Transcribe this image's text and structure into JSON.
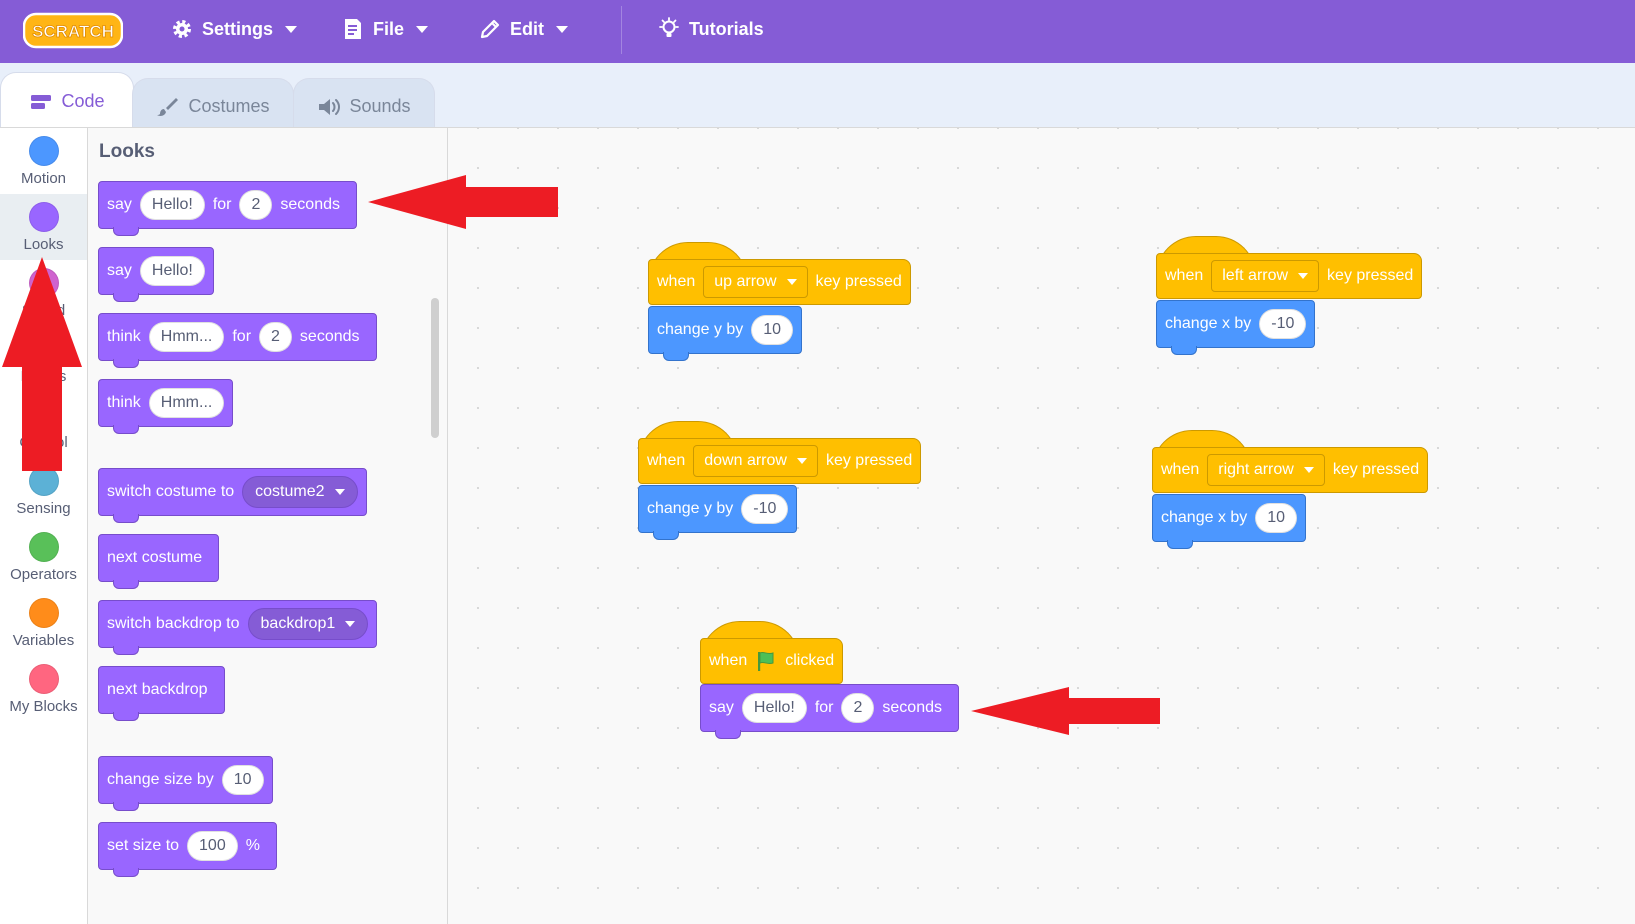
{
  "menu": {
    "logo_text": "SCRATCH",
    "settings": "Settings",
    "file": "File",
    "edit": "Edit",
    "tutorials": "Tutorials"
  },
  "tabs": [
    {
      "label": "Code",
      "icon": "code-icon",
      "active": true
    },
    {
      "label": "Costumes",
      "icon": "brush-icon",
      "active": false
    },
    {
      "label": "Sounds",
      "icon": "speaker-icon",
      "active": false
    }
  ],
  "categories": [
    {
      "label": "Motion",
      "color": "#4c97ff"
    },
    {
      "label": "Looks",
      "color": "#9966ff",
      "selected": true
    },
    {
      "label": "Sound",
      "color": "#cf63cf"
    },
    {
      "label": "Events",
      "color": "#ffbf00"
    },
    {
      "label": "Control",
      "color": "#ffab19"
    },
    {
      "label": "Sensing",
      "color": "#5cb1d6"
    },
    {
      "label": "Operators",
      "color": "#59c059"
    },
    {
      "label": "Variables",
      "color": "#ff8c1a"
    },
    {
      "label": "My Blocks",
      "color": "#ff6680"
    }
  ],
  "palette": {
    "title": "Looks",
    "say_for": {
      "say": "say",
      "msg": "Hello!",
      "for": "for",
      "secs": "2",
      "seconds": "seconds"
    },
    "say": {
      "say": "say",
      "msg": "Hello!"
    },
    "think_for": {
      "think": "think",
      "msg": "Hmm...",
      "for": "for",
      "secs": "2",
      "seconds": "seconds"
    },
    "think": {
      "think": "think",
      "msg": "Hmm..."
    },
    "switch_costume": {
      "label": "switch costume to",
      "value": "costume2"
    },
    "next_costume": "next costume",
    "switch_backdrop": {
      "label": "switch backdrop to",
      "value": "backdrop1"
    },
    "next_backdrop": "next backdrop",
    "change_size": {
      "label": "change size by",
      "value": "10"
    },
    "set_size": {
      "label": "set size to",
      "value": "100",
      "unit": "%"
    }
  },
  "workspace": {
    "up": {
      "when": "when",
      "key": "up arrow",
      "pressed": "key pressed",
      "action": "change y by",
      "value": "10"
    },
    "left": {
      "when": "when",
      "key": "left arrow",
      "pressed": "key pressed",
      "action": "change x by",
      "value": "-10"
    },
    "down": {
      "when": "when",
      "key": "down arrow",
      "pressed": "key pressed",
      "action": "change y by",
      "value": "-10"
    },
    "right": {
      "when": "when",
      "key": "right arrow",
      "pressed": "key pressed",
      "action": "change x by",
      "value": "10"
    },
    "flag": {
      "when": "when",
      "clicked": "clicked",
      "say": "say",
      "msg": "Hello!",
      "for": "for",
      "secs": "2",
      "seconds": "seconds"
    }
  },
  "colors": {
    "menu_bg": "#855cd6",
    "looks": "#9966ff",
    "motion": "#4c97ff",
    "events": "#ffbf00",
    "arrow": "#ed1c24"
  }
}
